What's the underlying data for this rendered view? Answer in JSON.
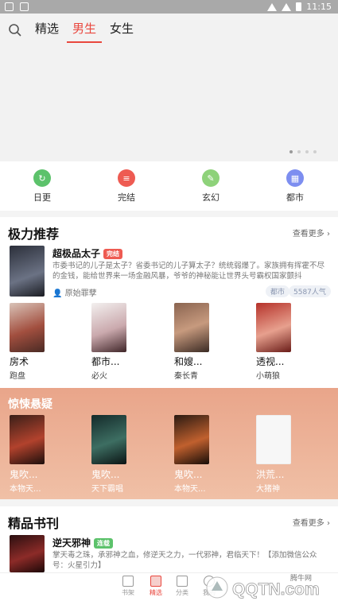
{
  "status_bar": {
    "time": "11:15"
  },
  "header": {
    "tabs": [
      {
        "label": "精选",
        "active": false
      },
      {
        "label": "男生",
        "active": true
      },
      {
        "label": "女生",
        "active": false
      }
    ],
    "accent_color": "#e9473e"
  },
  "categories": [
    {
      "label": "日更",
      "icon": "refresh-icon",
      "color": "#5cc26b"
    },
    {
      "label": "完结",
      "icon": "list-icon",
      "color": "#ee5b52"
    },
    {
      "label": "玄幻",
      "icon": "leaf-icon",
      "color": "#8ed27a"
    },
    {
      "label": "都市",
      "icon": "building-icon",
      "color": "#7d8ef0"
    }
  ],
  "recommend": {
    "title": "极力推荐",
    "more": "查看更多",
    "featured": {
      "title": "超极品太子",
      "badge": "完结",
      "description": "市委书记的儿子是太子？省委书记的儿子算太子？统统弱爆了。家族拥有挥霍不尽的金钱，能给世界来一场金融风暴，爷爷的神秘能让世界头号霸权国家颤抖",
      "author": "原始罪孽",
      "tags": [
        "都市",
        "5587人气"
      ]
    },
    "books": [
      {
        "title": "房术",
        "author": "跑盘"
      },
      {
        "title": "都市...",
        "author": "必火"
      },
      {
        "title": "和嫂...",
        "author": "秦长青"
      },
      {
        "title": "透视...",
        "author": "小萌狼"
      }
    ]
  },
  "suspense": {
    "title": "惊悚悬疑",
    "books": [
      {
        "title": "鬼吹...",
        "author": "本物天..."
      },
      {
        "title": "鬼吹...",
        "author": "天下霸唱"
      },
      {
        "title": "鬼吹...",
        "author": "本物天..."
      },
      {
        "title": "洪荒...",
        "author": "大猪神"
      }
    ]
  },
  "premium": {
    "title": "精品书刊",
    "more": "查看更多",
    "featured": {
      "title": "逆天邪神",
      "badge": "连载",
      "description": "掌天毒之珠，承邪神之血，修逆天之力，一代邪神，君临天下！【添加微信公众号：火星引力】"
    }
  },
  "bottom_nav": [
    {
      "label": "书架",
      "active": false
    },
    {
      "label": "精选",
      "active": true
    },
    {
      "label": "分类",
      "active": false
    },
    {
      "label": "我的",
      "active": false
    }
  ],
  "watermark": {
    "text": "QQTN.com",
    "sub": "腾牛网"
  }
}
